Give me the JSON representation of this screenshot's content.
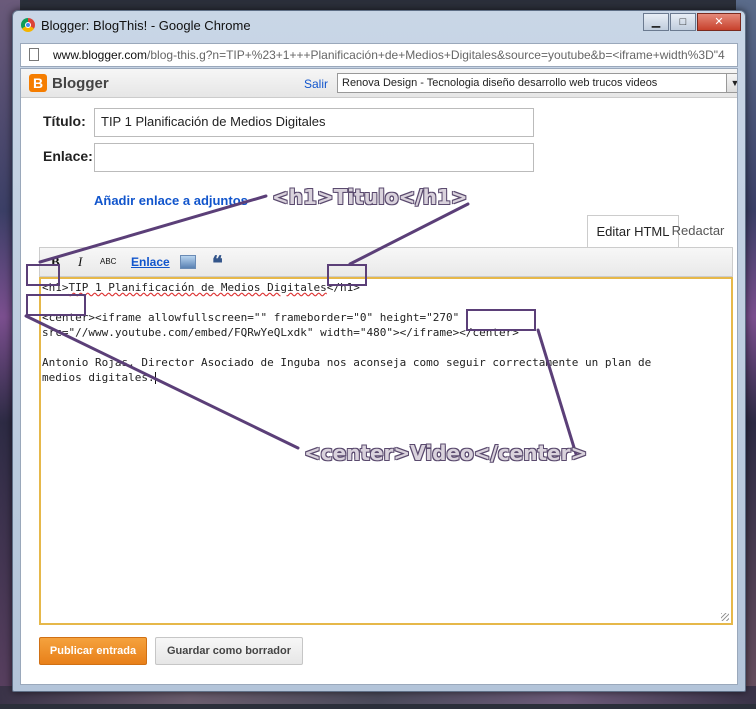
{
  "window": {
    "title": "Blogger: BlogThis! - Google Chrome",
    "minimize": "▁",
    "maximize": "□",
    "close": "✕"
  },
  "address": {
    "host": "www.blogger.com",
    "path": "/blog-this.g?n=TIP+%23+1+++Planificación+de+Medios+Digitales&source=youtube&b=<iframe+width%3D\"4"
  },
  "blogger": {
    "brand": "Blogger",
    "logout": "Salir",
    "selected_blog": "Renova Design - Tecnologia diseño desarrollo web trucos videos",
    "accent": "#f57d00"
  },
  "form": {
    "title_label": "Título:",
    "title_value": "TIP 1 Planificación de Medios Digitales",
    "link_label": "Enlace:",
    "link_value": "",
    "add_attachment": "Añadir enlace a adjuntos"
  },
  "tabs": {
    "html": "Editar HTML",
    "compose": "Redactar"
  },
  "toolbar": {
    "bold": "B",
    "italic": "I",
    "spell": "ABC",
    "link": "Enlace",
    "quote": "❝"
  },
  "editor": {
    "line1a": "<h1>",
    "line1b": "TIP 1 Planificación de Medios Digitales",
    "line1c": "</h1>",
    "line2a": "<center>",
    "line2b": "<iframe allowfullscreen=\"\" frameborder=\"0\" height=\"270\"",
    "line3a": "src=\"//www.youtube.com/embed/FQRwYeQLxdk\" width=\"480\"></iframe>",
    "line3b": "</center>",
    "line4": "Antonio Rojas, Director Asociado de Inguba nos aconseja como seguir correctamente un plan de",
    "line5": "medios digitales."
  },
  "buttons": {
    "publish": "Publicar entrada",
    "draft": "Guardar como borrador"
  },
  "annotations": {
    "h1_label": "<h1>Titulo</h1>",
    "center_label": "<center>Video</center>",
    "color": "#5b3f78"
  }
}
